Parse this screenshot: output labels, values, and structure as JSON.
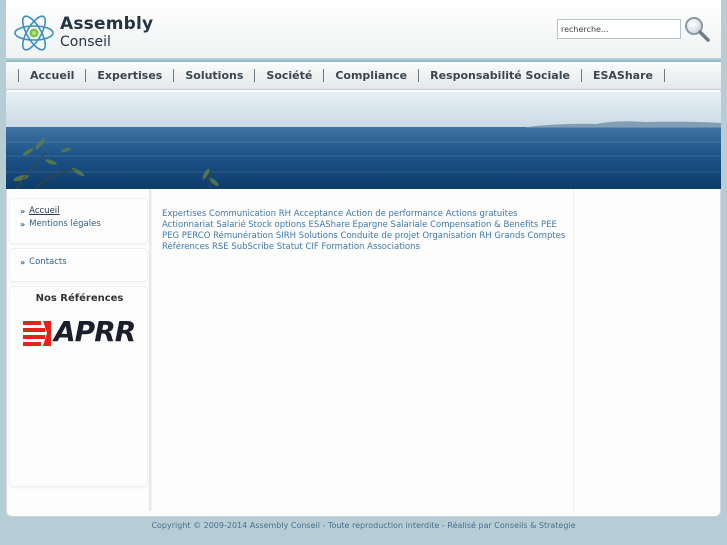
{
  "brand": {
    "title": "Assembly",
    "subtitle": "Conseil"
  },
  "search": {
    "placeholder": "recherche..."
  },
  "nav": {
    "items": [
      "Accueil",
      "Expertises",
      "Solutions",
      "Société",
      "Compliance",
      "Responsabilité Sociale",
      "ESAShare"
    ]
  },
  "sidebar": {
    "links": [
      {
        "label": "Accueil",
        "active": true
      },
      {
        "label": "Mentions légales",
        "active": false
      }
    ],
    "contact": "Contacts",
    "refs_title": "Nos Références",
    "ref_logo_text": "APRR"
  },
  "tags": [
    "Expertises",
    "Communication RH",
    "Acceptance",
    "Action de performance",
    "Actions gratuites",
    "Actionnariat Salarié",
    "Stock options",
    "ESAShare",
    "Epargne Salariale",
    "Compensation & Benefits",
    "PEE",
    "PEG",
    "PERCO",
    "Rémunération",
    "SIRH",
    "Solutions",
    "Conduite de projet",
    "Organisation RH",
    "Grands Comptes",
    "Références",
    "RSE",
    "SubScribe",
    "Statut",
    "CIF",
    "Formation",
    "Associations"
  ],
  "footer": {
    "text": "Copyright © 2009-2014 Assembly Conseil - Toute reproduction interdite - Réalisé par Conseils & Strategie"
  },
  "colors": {
    "page_bg": "#b7cdd5",
    "link": "#3e78a8",
    "brand_text": "#243442"
  },
  "icons": [
    "atom-logo-icon",
    "magnifier-icon",
    "double-arrow-icon",
    "aprr-logo-icon"
  ]
}
